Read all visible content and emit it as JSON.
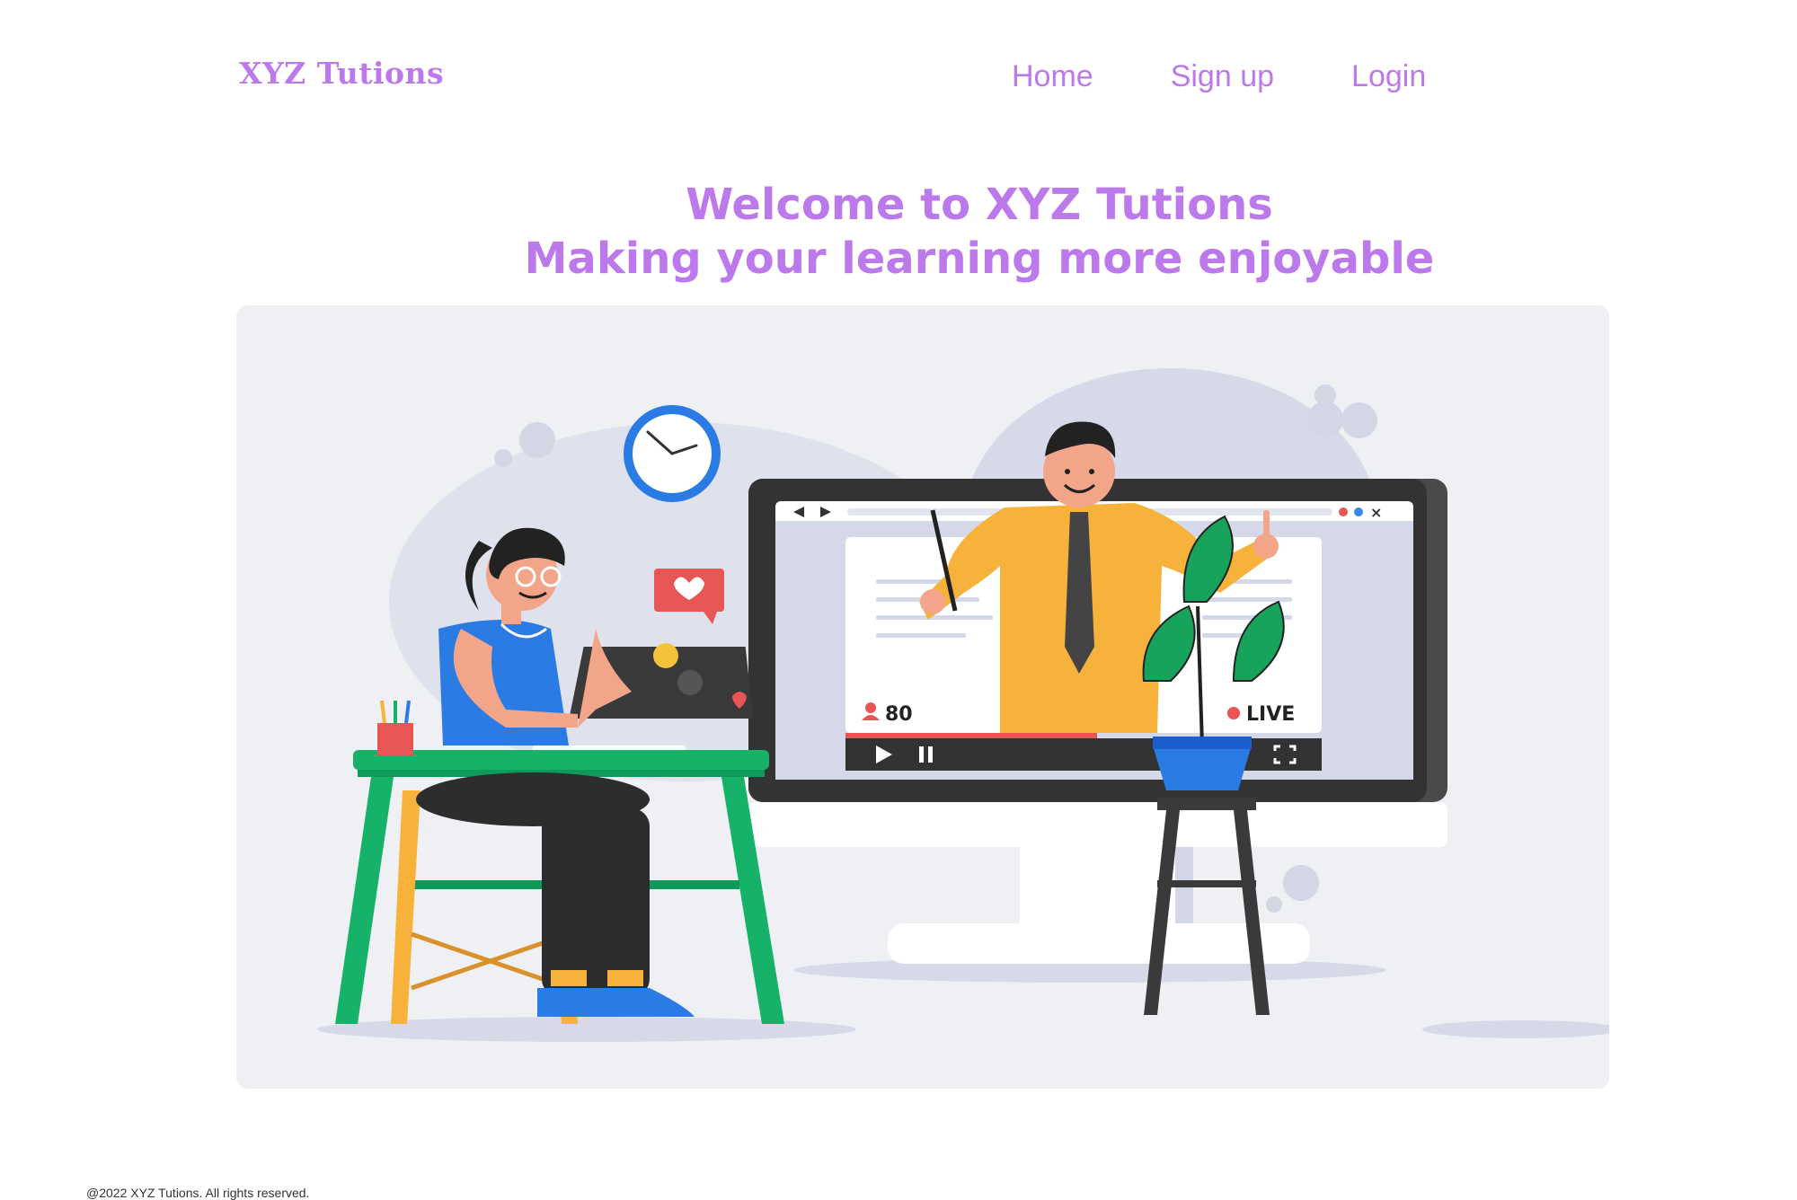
{
  "header": {
    "brand": "XYZ Tutions",
    "nav": [
      {
        "label": "Home"
      },
      {
        "label": "Sign up"
      },
      {
        "label": "Login"
      }
    ]
  },
  "hero": {
    "line1": "Welcome to XYZ Tutions",
    "line2": "Making your learning more enjoyable"
  },
  "illustration": {
    "viewer_count": "80",
    "live_label": "LIVE"
  },
  "footer": {
    "copyright": "@2022 XYZ Tutions. All rights reserved."
  },
  "colors": {
    "accent": "#bb79ec",
    "card_bg": "#eef0f4"
  }
}
